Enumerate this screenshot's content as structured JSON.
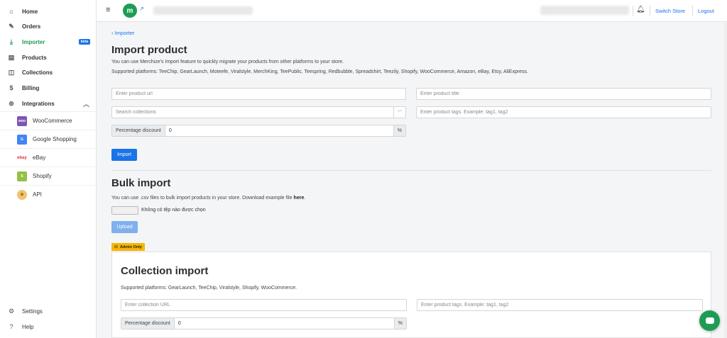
{
  "sidebar": {
    "items": [
      {
        "label": "Home",
        "icon": "home-icon"
      },
      {
        "label": "Orders",
        "icon": "edit-icon"
      },
      {
        "label": "Importer",
        "icon": "download-icon",
        "badge": "beta",
        "active": true
      },
      {
        "label": "Products",
        "icon": "box-icon"
      },
      {
        "label": "Collections",
        "icon": "layers-icon"
      },
      {
        "label": "Billing",
        "icon": "dollar-icon"
      },
      {
        "label": "Integrations",
        "icon": "plug-icon"
      }
    ],
    "integrations": [
      {
        "label": "WooCommerce",
        "icon": "woocommerce-icon"
      },
      {
        "label": "Google Shopping",
        "icon": "google-shopping-icon"
      },
      {
        "label": "eBay",
        "icon": "ebay-icon"
      },
      {
        "label": "Shopify",
        "icon": "shopify-icon"
      },
      {
        "label": "API",
        "icon": "api-icon"
      }
    ],
    "bottom": [
      {
        "label": "Settings",
        "icon": "gear-icon"
      },
      {
        "label": "Help",
        "icon": "help-icon"
      }
    ]
  },
  "topbar": {
    "switch_store": "Switch Store",
    "logout": "Logout",
    "brand_letter": "m"
  },
  "import_product": {
    "back_label": "Importer",
    "title": "Import product",
    "desc1": "You can use Merchize's Import feature to quickly migrate your products from other platforms to your store.",
    "desc2": "Supported platforms: TeeChip, GearLaunch, Moteefe, Viralstyle, MerchKing, TeePublic, Teespring, Redbubble, Spreadshirt, Teezily, Shopify, WooCommerce, Amazon, eBay, Etsy, AliExpress.",
    "url_placeholder": "Enter product url",
    "title_placeholder": "Enter product title",
    "collections_placeholder": "Search collections",
    "tags_placeholder": "Enter product tags. Example: tag1, tag2",
    "discount_label": "Percentage discount",
    "discount_value": "0",
    "percent": "%",
    "import_button": "Import"
  },
  "bulk_import": {
    "title": "Bulk import",
    "desc": "You can use .csv files to bulk import products in your store. Download example file",
    "here_link": "here",
    "period": ".",
    "file_status": "Không có tệp nào được chọn",
    "upload_button": "Upload"
  },
  "collection_import": {
    "badge": "Admin Only",
    "title": "Collection import",
    "desc": "Supported platforms: GearLaunch, TeeChip, Viralstyle, Shopify, WooCommerce.",
    "url_placeholder": "Enter collection URL",
    "tags_placeholder": "Enter product tags. Example: tag1, tag2",
    "discount_label": "Percentage discount",
    "discount_value": "0",
    "percent": "%"
  },
  "colors": {
    "accent": "#1a73e8",
    "brand": "#1d9d54",
    "admin_badge": "#f7b500"
  }
}
